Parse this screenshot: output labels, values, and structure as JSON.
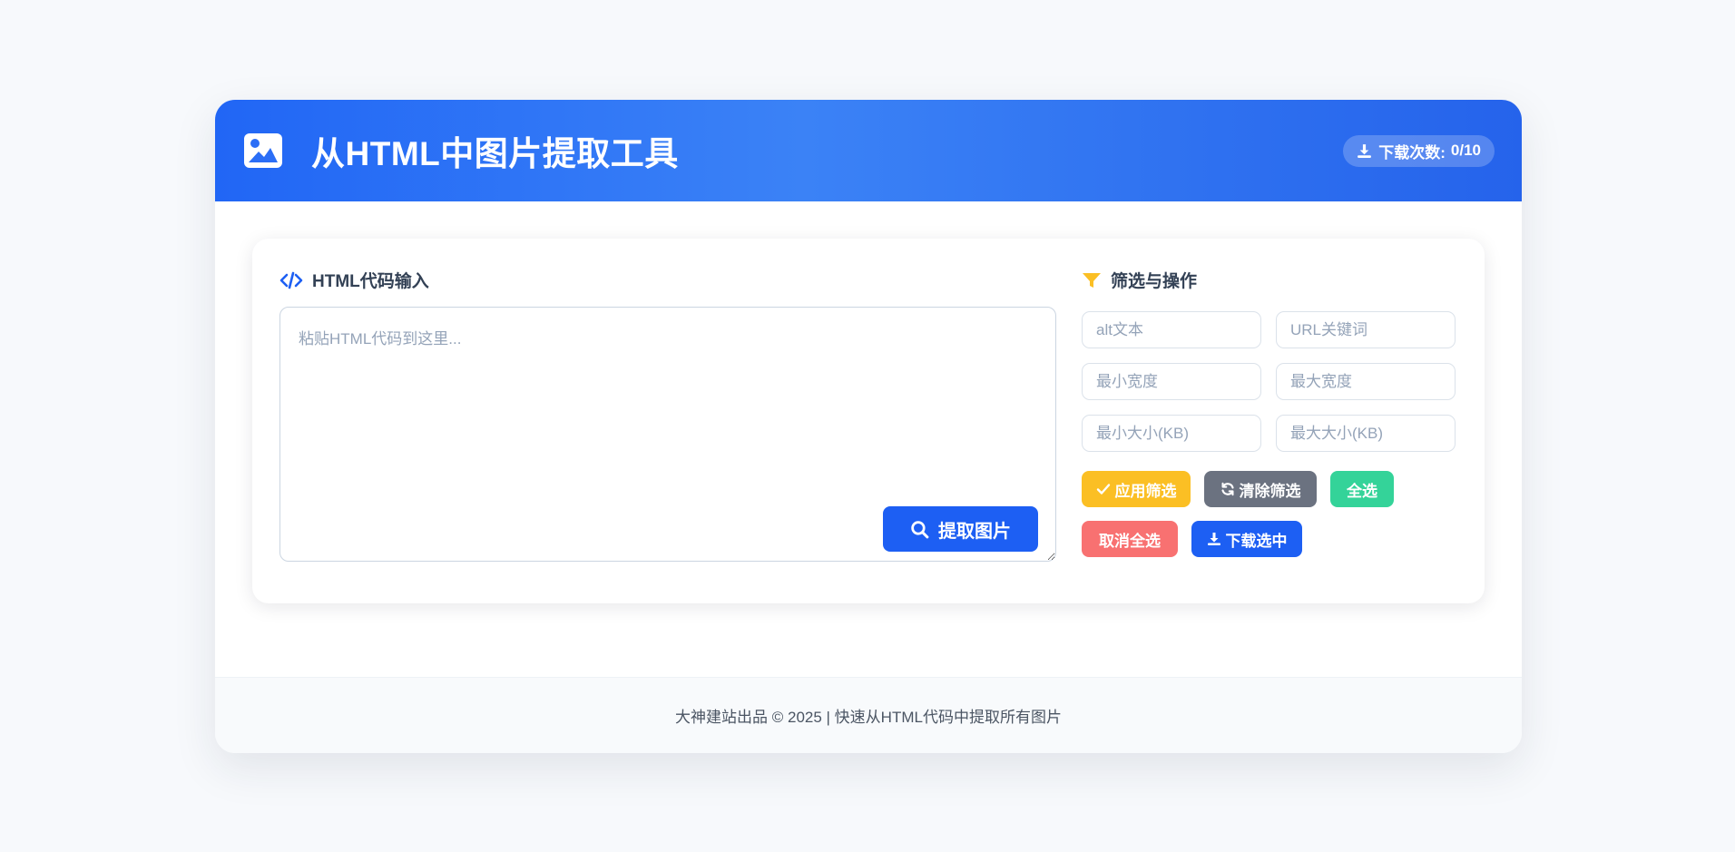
{
  "header": {
    "title": "从HTML中图片提取工具",
    "counter_label": "下载次数:",
    "counter_value": "0/10"
  },
  "input_section": {
    "title": "HTML代码输入",
    "placeholder": "粘贴HTML代码到这里...",
    "extract_button": "提取图片"
  },
  "filter_section": {
    "title": "筛选与操作",
    "fields": {
      "alt": "alt文本",
      "url": "URL关键词",
      "min_width": "最小宽度",
      "max_width": "最大宽度",
      "min_size": "最小大小(KB)",
      "max_size": "最大大小(KB)"
    },
    "buttons": {
      "apply": "应用筛选",
      "clear": "清除筛选",
      "select_all": "全选",
      "deselect_all": "取消全选",
      "download_selected": "下载选中"
    }
  },
  "footer": {
    "text": "大神建站出品 © 2025 | 快速从HTML代码中提取所有图片"
  },
  "colors": {
    "primary": "#1d5ff3",
    "warning": "#fbbf24",
    "neutral": "#6b7280",
    "success": "#34d399",
    "danger": "#f87171"
  }
}
